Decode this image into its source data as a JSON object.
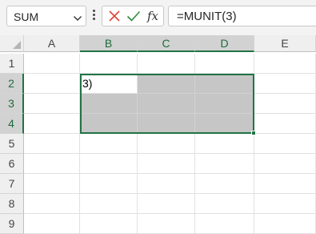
{
  "name_box": {
    "value": "SUM",
    "dropdown_icon": "chevron-down-icon"
  },
  "formula_bar": {
    "cancel_icon": "close-icon",
    "enter_icon": "check-icon",
    "function_label": "fx",
    "formula": "=MUNIT(3)"
  },
  "columns": [
    "A",
    "B",
    "C",
    "D",
    "E"
  ],
  "rows": [
    "1",
    "2",
    "3",
    "4",
    "5",
    "6",
    "7",
    "8",
    "9"
  ],
  "selected_columns": [
    "B",
    "C",
    "D"
  ],
  "selected_rows": [
    "2",
    "3",
    "4"
  ],
  "active_cell": {
    "ref": "B2",
    "edit_text": "3)"
  },
  "colors": {
    "accent": "#217346",
    "selection_fill": "#c6c6c6",
    "cancel": "#e0453a",
    "enter": "#2e8b3c"
  }
}
